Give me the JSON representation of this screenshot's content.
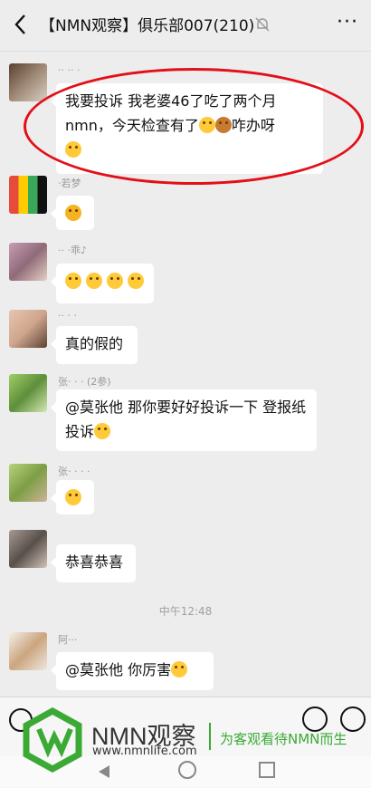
{
  "header": {
    "back_icon": "chevron-left-icon",
    "title": "【NMN观察】俱乐部007(210)",
    "mute_icon": "bell-muted-icon",
    "more_label": "···"
  },
  "messages": [
    {
      "sender": "·· ·· ·",
      "text": "我要投诉  我老婆46了吃了两个月nmn，今天检查有了",
      "trailing": "咋办呀"
    },
    {
      "sender": "·若梦",
      "text": ""
    },
    {
      "sender": "·· ·乖♪",
      "text": ""
    },
    {
      "sender": "·· · ·",
      "text": "真的假的"
    },
    {
      "sender": "张· · · (2参)",
      "text": "@莫张他   那你要好好投诉一下 登报纸投诉"
    },
    {
      "sender": "张· · · ·",
      "text": ""
    },
    {
      "sender": "",
      "text": "恭喜恭喜"
    },
    {
      "sender": "阿···",
      "text": "@莫张他   你厉害"
    }
  ],
  "timestamp": "中午12:48",
  "brand": {
    "name": "NMN观察",
    "url": "www.nmnlife.com",
    "slogan": "为客观看待NMN而生",
    "green": "#3aaa35"
  },
  "highlight_color": "#e30f17"
}
